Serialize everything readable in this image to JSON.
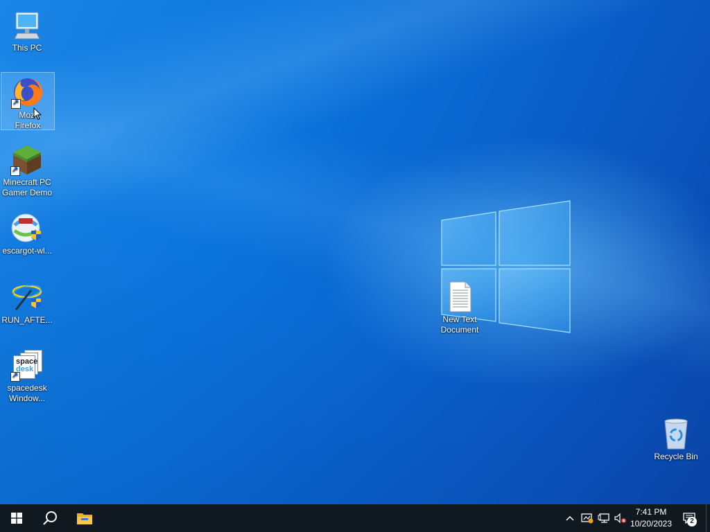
{
  "desktop": {
    "icons": [
      {
        "label": "This PC",
        "icon": "computer-icon"
      },
      {
        "label": "Mozilla Firefox",
        "label_line1": "Mozi",
        "label_line2": "Firefox",
        "icon": "firefox-icon"
      },
      {
        "label_line1": "Minecraft PC",
        "label_line2": "Gamer Demo",
        "icon": "minecraft-icon"
      },
      {
        "label": "escargot-wl...",
        "icon": "escargot-installer-icon"
      },
      {
        "label": "RUN_AFTE...",
        "icon": "setup-shortcut-icon"
      },
      {
        "label_line1": "spacedesk",
        "label_line2": "Window...",
        "icon": "spacedesk-icon",
        "logo_text_1": "space",
        "logo_text_2": "desk"
      },
      {
        "label_line1": "New Text",
        "label_line2": "Document",
        "icon": "text-document-icon"
      },
      {
        "label": "Recycle Bin",
        "icon": "recycle-bin-icon"
      }
    ]
  },
  "taskbar": {
    "start": {
      "icon": "windows-start-icon"
    },
    "search": {
      "icon": "search-icon"
    },
    "pinned": [
      {
        "icon": "file-explorer-icon"
      }
    ],
    "tray": {
      "chevron_icon": "chevron-up-icon",
      "icons": [
        "security-center-icon",
        "network-icon",
        "volume-muted-icon"
      ],
      "time": "7:41 PM",
      "date": "10/20/2023",
      "notifications_count": "2",
      "notifications_icon": "action-center-icon"
    }
  },
  "colors": {
    "taskbar": "#101820",
    "accent": "#0a6fd8"
  }
}
